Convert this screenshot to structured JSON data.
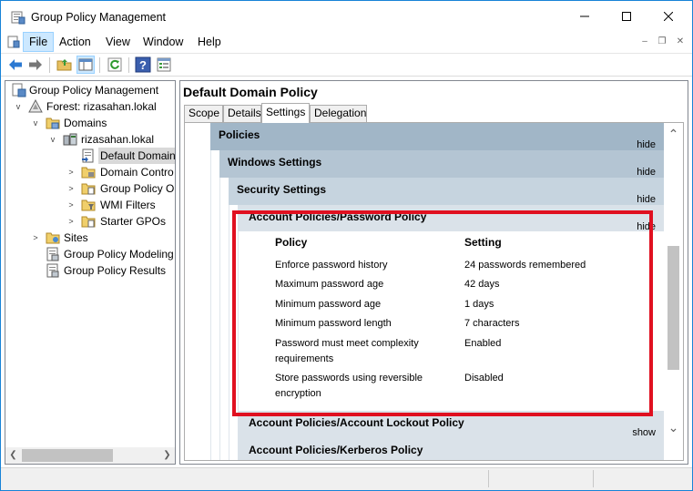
{
  "window": {
    "title": "Group Policy Management"
  },
  "menu": [
    "File",
    "Action",
    "View",
    "Window",
    "Help"
  ],
  "mdi_controls": [
    "–",
    "❐",
    "✕"
  ],
  "toolbar": {
    "icons": [
      "back-arrow-icon",
      "forward-arrow-icon",
      "up-folder-icon",
      "show-tree-icon",
      "refresh-icon",
      "help-icon",
      "properties-icon"
    ]
  },
  "tree": {
    "items": [
      {
        "label": "Group Policy Management",
        "icon": "gpm-console-icon",
        "expander": ""
      },
      {
        "label": "Forest: rizasahan.lokal",
        "icon": "forest-icon",
        "expander": "v"
      },
      {
        "label": "Domains",
        "icon": "folder-icon",
        "expander": "v"
      },
      {
        "label": "rizasahan.lokal",
        "icon": "domain-icon",
        "expander": "v"
      },
      {
        "label": "Default Domain",
        "icon": "gpo-link-icon",
        "expander": ""
      },
      {
        "label": "Domain Contro",
        "icon": "ou-folder-icon",
        "expander": ">"
      },
      {
        "label": "Group Policy Ob",
        "icon": "folder-icon",
        "expander": ">"
      },
      {
        "label": "WMI Filters",
        "icon": "folder-icon",
        "expander": ">"
      },
      {
        "label": "Starter GPOs",
        "icon": "folder-icon",
        "expander": ">"
      },
      {
        "label": "Sites",
        "icon": "sites-icon",
        "expander": ">"
      },
      {
        "label": "Group Policy Modeling",
        "icon": "modeling-icon",
        "expander": ""
      },
      {
        "label": "Group Policy Results",
        "icon": "results-icon",
        "expander": ""
      }
    ]
  },
  "right": {
    "title": "Default Domain Policy",
    "tabs": [
      "Scope",
      "Details",
      "Settings",
      "Delegation"
    ],
    "active_tab": "Settings",
    "sections": {
      "policies": {
        "title": "Policies",
        "toggle": "hide"
      },
      "windows_settings": {
        "title": "Windows Settings",
        "toggle": "hide"
      },
      "security_settings": {
        "title": "Security Settings",
        "toggle": "hide"
      },
      "password_policy": {
        "title": "Account Policies/Password Policy",
        "toggle": "hide"
      },
      "lockout_policy": {
        "title": "Account Policies/Account Lockout Policy",
        "toggle": "show"
      },
      "kerberos_policy": {
        "title": "Account Policies/Kerberos Policy"
      }
    },
    "table": {
      "headers": {
        "policy": "Policy",
        "setting": "Setting"
      },
      "rows": [
        {
          "policy": "Enforce password history",
          "setting": "24 passwords remembered"
        },
        {
          "policy": "Maximum password age",
          "setting": "42 days"
        },
        {
          "policy": "Minimum password age",
          "setting": "1 days"
        },
        {
          "policy": "Minimum password length",
          "setting": "7 characters"
        },
        {
          "policy": "Password must meet complexity requirements",
          "setting": "Enabled"
        },
        {
          "policy": "Store passwords using reversible encryption",
          "setting": "Disabled"
        }
      ]
    }
  },
  "colors": {
    "highlight_box": "#e01020",
    "accent": "#1883d7"
  }
}
